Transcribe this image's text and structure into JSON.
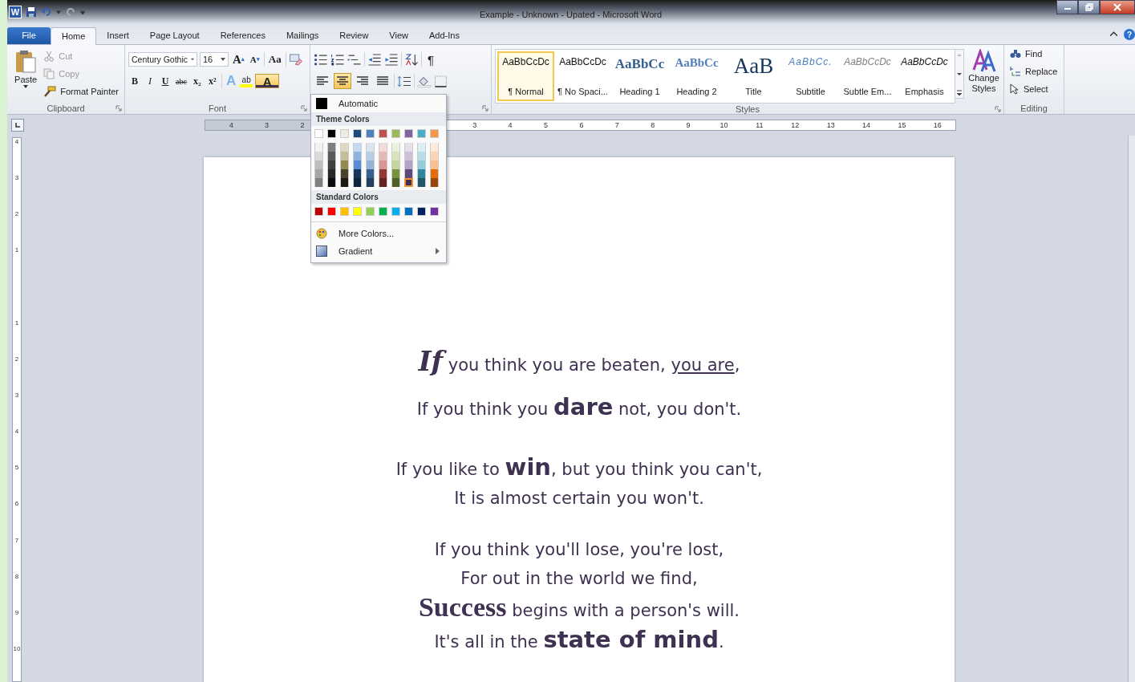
{
  "window": {
    "app_letter": "W",
    "title": "Example - Unknown - Upated - Microsoft Word",
    "help": "?"
  },
  "tabs": [
    {
      "label": "File",
      "kind": "file",
      "selected": false
    },
    {
      "label": "Home",
      "kind": "tab",
      "selected": true
    },
    {
      "label": "Insert",
      "kind": "tab",
      "selected": false
    },
    {
      "label": "Page Layout",
      "kind": "tab",
      "selected": false
    },
    {
      "label": "References",
      "kind": "tab",
      "selected": false
    },
    {
      "label": "Mailings",
      "kind": "tab",
      "selected": false
    },
    {
      "label": "Review",
      "kind": "tab",
      "selected": false
    },
    {
      "label": "View",
      "kind": "tab",
      "selected": false
    },
    {
      "label": "Add-Ins",
      "kind": "tab",
      "selected": false
    }
  ],
  "clipboard": {
    "label": "Clipboard",
    "paste": "Paste",
    "actions": [
      {
        "label": "Cut",
        "kind": "cut",
        "disabled": true
      },
      {
        "label": "Copy",
        "kind": "copy",
        "disabled": true
      },
      {
        "label": "Format Painter",
        "kind": "painter",
        "disabled": false
      }
    ]
  },
  "font": {
    "label": "Font",
    "name": "Century Gothic",
    "size": "16",
    "grow": "A",
    "grow_mark": "▴",
    "shrink": "A",
    "shrink_mark": "▾",
    "change_case": "Aa",
    "format_buttons": [
      {
        "label": "B",
        "kind": "bold"
      },
      {
        "label": "I",
        "kind": "italic"
      },
      {
        "label": "U",
        "kind": "underline"
      },
      {
        "label": "abc",
        "kind": "strike"
      },
      {
        "label": "x₂",
        "kind": "sub"
      },
      {
        "label": "x²",
        "kind": "sup"
      }
    ],
    "effects": "A",
    "highlight": "ab",
    "font_color": {
      "label": "A",
      "expanded": true
    }
  },
  "paragraph": {
    "pilcrow": "¶",
    "alignments": [
      {
        "kind": "left",
        "selected": false
      },
      {
        "kind": "center",
        "selected": true
      },
      {
        "kind": "right",
        "selected": false
      },
      {
        "kind": "justify",
        "selected": false
      }
    ]
  },
  "font_color_menu": {
    "automatic": "Automatic",
    "theme_heading": "Theme Colors",
    "theme_colors": [
      {
        "color": "#ffffff",
        "selected": false
      },
      {
        "color": "#000000",
        "selected": false
      },
      {
        "color": "#eeece1",
        "selected": false
      },
      {
        "color": "#1f497d",
        "selected": false
      },
      {
        "color": "#4f81bd",
        "selected": false
      },
      {
        "color": "#c0504d",
        "selected": false
      },
      {
        "color": "#9bbb59",
        "selected": false
      },
      {
        "color": "#8064a2",
        "selected": false
      },
      {
        "color": "#4bacc6",
        "selected": false
      },
      {
        "color": "#f79646",
        "selected": false
      }
    ],
    "shade_rows": [
      [
        {
          "color": "#f2f2f2",
          "selected": false
        },
        {
          "color": "#7f7f7f",
          "selected": false
        },
        {
          "color": "#ddd9c3",
          "selected": false
        },
        {
          "color": "#c6d9f0",
          "selected": false
        },
        {
          "color": "#dbe5f1",
          "selected": false
        },
        {
          "color": "#f2dcdb",
          "selected": false
        },
        {
          "color": "#ebf1dd",
          "selected": false
        },
        {
          "color": "#e5e0ec",
          "selected": false
        },
        {
          "color": "#dbeef3",
          "selected": false
        },
        {
          "color": "#fdeada",
          "selected": false
        }
      ],
      [
        {
          "color": "#d9d9d9",
          "selected": false
        },
        {
          "color": "#595959",
          "selected": false
        },
        {
          "color": "#c4bd97",
          "selected": false
        },
        {
          "color": "#8db3e2",
          "selected": false
        },
        {
          "color": "#b8cce4",
          "selected": false
        },
        {
          "color": "#e5b9b7",
          "selected": false
        },
        {
          "color": "#d7e3bc",
          "selected": false
        },
        {
          "color": "#ccc1d9",
          "selected": false
        },
        {
          "color": "#b7dde8",
          "selected": false
        },
        {
          "color": "#fbd5b5",
          "selected": false
        }
      ],
      [
        {
          "color": "#bfbfbf",
          "selected": false
        },
        {
          "color": "#404040",
          "selected": false
        },
        {
          "color": "#938953",
          "selected": false
        },
        {
          "color": "#548dd4",
          "selected": false
        },
        {
          "color": "#95b3d7",
          "selected": false
        },
        {
          "color": "#d99694",
          "selected": false
        },
        {
          "color": "#c3d69b",
          "selected": false
        },
        {
          "color": "#b2a2c7",
          "selected": false
        },
        {
          "color": "#92cddc",
          "selected": false
        },
        {
          "color": "#fac08f",
          "selected": false
        }
      ],
      [
        {
          "color": "#a6a6a6",
          "selected": false
        },
        {
          "color": "#262626",
          "selected": false
        },
        {
          "color": "#494429",
          "selected": false
        },
        {
          "color": "#17365d",
          "selected": false
        },
        {
          "color": "#366092",
          "selected": false
        },
        {
          "color": "#953734",
          "selected": false
        },
        {
          "color": "#76923c",
          "selected": false
        },
        {
          "color": "#5f497a",
          "selected": false
        },
        {
          "color": "#31859b",
          "selected": false
        },
        {
          "color": "#e36c09",
          "selected": false
        }
      ],
      [
        {
          "color": "#808080",
          "selected": false
        },
        {
          "color": "#0d0d0d",
          "selected": false
        },
        {
          "color": "#1d1b10",
          "selected": false
        },
        {
          "color": "#0f243e",
          "selected": false
        },
        {
          "color": "#244061",
          "selected": false
        },
        {
          "color": "#632423",
          "selected": false
        },
        {
          "color": "#4f6128",
          "selected": false
        },
        {
          "color": "#3f3151",
          "selected": true
        },
        {
          "color": "#205867",
          "selected": false
        },
        {
          "color": "#974806",
          "selected": false
        }
      ]
    ],
    "standard_heading": "Standard Colors",
    "standard_colors": [
      {
        "color": "#c00000",
        "selected": false
      },
      {
        "color": "#ff0000",
        "selected": false
      },
      {
        "color": "#ffc000",
        "selected": false
      },
      {
        "color": "#ffff00",
        "selected": false
      },
      {
        "color": "#92d050",
        "selected": false
      },
      {
        "color": "#00b050",
        "selected": false
      },
      {
        "color": "#00b0f0",
        "selected": false
      },
      {
        "color": "#0070c0",
        "selected": false
      },
      {
        "color": "#002060",
        "selected": false
      },
      {
        "color": "#7030a0",
        "selected": false
      }
    ],
    "more_colors": "More Colors...",
    "gradient": "Gradient"
  },
  "styles": {
    "label": "Styles",
    "items": [
      {
        "preview": "AaBbCcDc",
        "name": "¶ Normal",
        "kind": "normal",
        "selected": true
      },
      {
        "preview": "AaBbCcDc",
        "name": "¶ No Spaci...",
        "kind": "normal",
        "selected": false
      },
      {
        "preview": "AaBbCc",
        "name": "Heading 1",
        "kind": "heading1",
        "selected": false
      },
      {
        "preview": "AaBbCc",
        "name": "Heading 2",
        "kind": "heading2",
        "selected": false
      },
      {
        "preview": "AaB",
        "name": "Title",
        "kind": "title",
        "selected": false
      },
      {
        "preview": "AaBbCc.",
        "name": "Subtitle",
        "kind": "subtitle",
        "selected": false
      },
      {
        "preview": "AaBbCcDc",
        "name": "Subtle Em...",
        "kind": "subtle",
        "selected": false
      },
      {
        "preview": "AaBbCcDc",
        "name": "Emphasis",
        "kind": "emphasis",
        "selected": false
      }
    ],
    "change_styles": "Change Styles"
  },
  "editing": {
    "label": "Editing",
    "items": [
      {
        "label": "Find",
        "kind": "find"
      },
      {
        "label": "Replace",
        "kind": "replace"
      },
      {
        "label": "Select",
        "kind": "select"
      }
    ]
  },
  "ruler": {
    "left_numbers": [
      "4",
      "3",
      "2"
    ],
    "right_numbers": [
      "3",
      "4",
      "5",
      "6",
      "7",
      "8",
      "9",
      "10",
      "11",
      "12",
      "13",
      "14",
      "15",
      "16"
    ],
    "top_numbers": [
      "4",
      "3",
      "2",
      "1"
    ],
    "side_numbers": [
      "1",
      "2",
      "3",
      "4",
      "5",
      "6",
      "7",
      "8",
      "9",
      "10"
    ]
  },
  "document": {
    "stanzas": [
      {
        "lines": [
          {
            "segments": [
              {
                "text": "If",
                "kind": "fancy"
              },
              {
                "text": " you think you are beaten, ",
                "kind": "plain"
              },
              {
                "text": "you are",
                "kind": "underline"
              },
              {
                "text": ",",
                "kind": "plain"
              }
            ]
          },
          {
            "segments": [
              {
                "text": "If you think you ",
                "kind": "plain"
              },
              {
                "text": "dare",
                "kind": "bold"
              },
              {
                "text": " not, you don't.",
                "kind": "plain"
              }
            ]
          }
        ]
      },
      {
        "lines": [
          {
            "segments": [
              {
                "text": "If you like to ",
                "kind": "plain"
              },
              {
                "text": "win",
                "kind": "bold"
              },
              {
                "text": ", but you think you can't,",
                "kind": "plain"
              }
            ]
          },
          {
            "segments": [
              {
                "text": "It is almost certain you won't.",
                "kind": "plain"
              }
            ]
          }
        ]
      },
      {
        "lines": [
          {
            "segments": [
              {
                "text": "If you think you'll lose, you're lost,",
                "kind": "plain"
              }
            ]
          },
          {
            "segments": [
              {
                "text": "For out in the world we find,",
                "kind": "plain"
              }
            ]
          },
          {
            "segments": [
              {
                "text": "Success",
                "kind": "serif"
              },
              {
                "text": " begins with a person's will.",
                "kind": "plain"
              }
            ]
          },
          {
            "segments": [
              {
                "text": "It's all in the ",
                "kind": "plain"
              },
              {
                "text": "state of mind",
                "kind": "bold"
              },
              {
                "text": ".",
                "kind": "plain"
              }
            ]
          }
        ]
      }
    ]
  }
}
